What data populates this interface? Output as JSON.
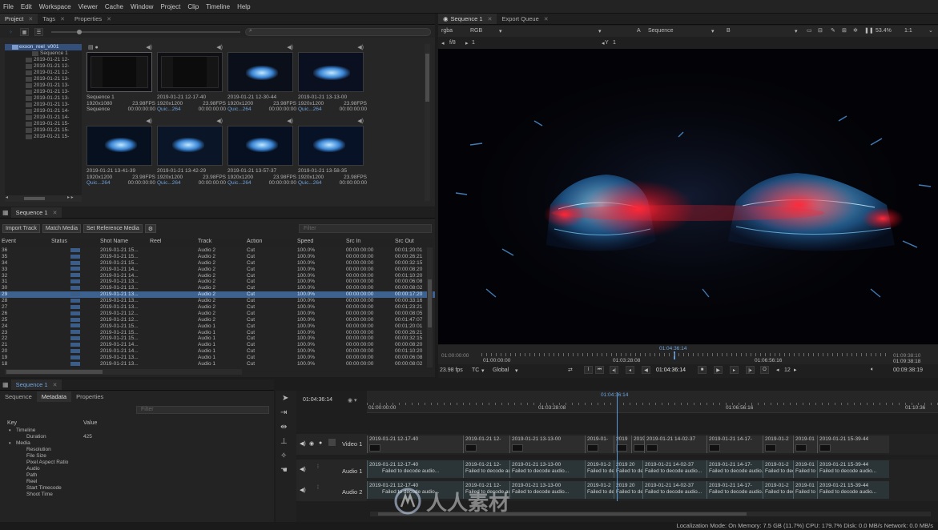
{
  "menu": [
    "File",
    "Edit",
    "Workspace",
    "Viewer",
    "Cache",
    "Window",
    "Project",
    "Clip",
    "Timeline",
    "Help"
  ],
  "project_panel": {
    "tabs": [
      "Project",
      "Tags",
      "Properties"
    ],
    "root_item": "exxon_reel_v001",
    "bin_items": [
      "Sequence 1",
      "2019-01-21 12-",
      "2019-01-21 12-",
      "2019-01-21 12-",
      "2019-01-21 13-",
      "2019-01-21 13-",
      "2019-01-21 13-",
      "2019-01-21 13-",
      "2019-01-21 13-",
      "2019-01-21 14-",
      "2019-01-21 14-",
      "2019-01-21 15-",
      "2019-01-21 15-",
      "2019-01-21 15-"
    ],
    "thumbnails": [
      {
        "name": "Sequence 1",
        "res": "1920x1080",
        "fps": "23.98FPS",
        "type": "Sequence",
        "tc": "00:00:00:00"
      },
      {
        "name": "2019-01-21 12-17-40",
        "res": "1920x1200",
        "fps": "23.98FPS",
        "type": "Quic...264",
        "tc": "00:00:00:00"
      },
      {
        "name": "2019-01-21 12-30-44",
        "res": "1920x1200",
        "fps": "23.98FPS",
        "type": "Quic...264",
        "tc": "00:00:00:00"
      },
      {
        "name": "2019-01-21 13-13-00",
        "res": "1920x1200",
        "fps": "23.98FPS",
        "type": "Quic...264",
        "tc": "00:00:00:00"
      },
      {
        "name": "2019-01-21 13-41-39",
        "res": "1920x1200",
        "fps": "23.98FPS",
        "type": "Quic...264",
        "tc": "00:00:00:00"
      },
      {
        "name": "2019-01-21 13-42-29",
        "res": "1920x1200",
        "fps": "23.98FPS",
        "type": "Quic...264",
        "tc": "00:00:00:00"
      },
      {
        "name": "2019-01-21 13-57-37",
        "res": "1920x1200",
        "fps": "23.98FPS",
        "type": "Quic...264",
        "tc": "00:00:00:00"
      },
      {
        "name": "2019-01-21 13-58-35",
        "res": "1920x1200",
        "fps": "23.98FPS",
        "type": "Quic...264",
        "tc": "00:00:00:00"
      }
    ]
  },
  "sequence_panel": {
    "tab": "Sequence 1",
    "buttons": [
      "Import Track",
      "Match Media",
      "Set Reference Media"
    ],
    "filter_placeholder": "Filter",
    "columns": [
      "Event",
      "Status",
      "Shot Name",
      "Reel",
      "Track",
      "Action",
      "Speed",
      "Src In",
      "Src Out"
    ],
    "rows": [
      [
        "36",
        "",
        "2019-01-21 15...",
        "",
        "Audio 2",
        "Cut",
        "100.0%",
        "00:00:00:00",
        "00:01:20:01"
      ],
      [
        "35",
        "",
        "2019-01-21 15...",
        "",
        "Audio 2",
        "Cut",
        "100.0%",
        "00:00:00:00",
        "00:00:26:21"
      ],
      [
        "34",
        "",
        "2019-01-21 15...",
        "",
        "Audio 2",
        "Cut",
        "100.0%",
        "00:00:00:00",
        "00:00:32:15"
      ],
      [
        "33",
        "",
        "2019-01-21 14...",
        "",
        "Audio 2",
        "Cut",
        "100.0%",
        "00:00:00:00",
        "00:00:08:20"
      ],
      [
        "32",
        "",
        "2019-01-21 14...",
        "",
        "Audio 2",
        "Cut",
        "100.0%",
        "00:00:00:00",
        "00:01:10:20"
      ],
      [
        "31",
        "",
        "2019-01-21 13...",
        "",
        "Audio 2",
        "Cut",
        "100.0%",
        "00:00:00:00",
        "00:00:06:08"
      ],
      [
        "30",
        "",
        "2019-01-21 13...",
        "",
        "Audio 2",
        "Cut",
        "100.0%",
        "00:00:00:00",
        "00:00:08:02"
      ],
      [
        "29",
        "",
        "2019-01-21 13...",
        "",
        "Audio 2",
        "Cut",
        "100.0%",
        "00:00:00:00",
        "00:00:17:20"
      ],
      [
        "28",
        "",
        "2019-01-21 13...",
        "",
        "Audio 2",
        "Cut",
        "100.0%",
        "00:00:00:00",
        "00:00:33:16"
      ],
      [
        "27",
        "",
        "2019-01-21 13...",
        "",
        "Audio 2",
        "Cut",
        "100.0%",
        "00:00:00:00",
        "00:01:23:21"
      ],
      [
        "26",
        "",
        "2019-01-21 12...",
        "",
        "Audio 2",
        "Cut",
        "100.0%",
        "00:00:00:00",
        "00:00:08:05"
      ],
      [
        "25",
        "",
        "2019-01-21 12...",
        "",
        "Audio 2",
        "Cut",
        "100.0%",
        "00:00:00:00",
        "00:01:47:07"
      ],
      [
        "24",
        "",
        "2019-01-21 15...",
        "",
        "Audio 1",
        "Cut",
        "100.0%",
        "00:00:00:00",
        "00:01:20:01"
      ],
      [
        "23",
        "",
        "2019-01-21 15...",
        "",
        "Audio 1",
        "Cut",
        "100.0%",
        "00:00:00:00",
        "00:00:26:21"
      ],
      [
        "22",
        "",
        "2019-01-21 15...",
        "",
        "Audio 1",
        "Cut",
        "100.0%",
        "00:00:00:00",
        "00:00:32:15"
      ],
      [
        "21",
        "",
        "2019-01-21 14...",
        "",
        "Audio 1",
        "Cut",
        "100.0%",
        "00:00:00:00",
        "00:00:08:20"
      ],
      [
        "20",
        "",
        "2019-01-21 14...",
        "",
        "Audio 1",
        "Cut",
        "100.0%",
        "00:00:00:00",
        "00:01:10:20"
      ],
      [
        "19",
        "",
        "2019-01-21 13...",
        "",
        "Audio 1",
        "Cut",
        "100.0%",
        "00:00:00:00",
        "00:00:06:08"
      ],
      [
        "18",
        "",
        "2019-01-21 13...",
        "",
        "Audio 1",
        "Cut",
        "100.0%",
        "00:00:00:00",
        "00:00:08:02"
      ]
    ],
    "selected_event": "29"
  },
  "viewer": {
    "tabs": [
      "Sequence 1",
      "Export Queue"
    ],
    "channel": "rgba",
    "colorspace": "RGB",
    "layer": "A",
    "sequence_name": "Sequence",
    "zoom": "53.4%",
    "ratio": "1:1",
    "fstop": "f/8",
    "exposure": "1",
    "gamma": "1",
    "tc_start": "01:00:00:00",
    "tc_end": "01:09:38:10",
    "tc_marker": "01:04:36:14",
    "tc_in": "01:00:00:00",
    "tc_mid1": "01:03:28:08",
    "tc_mid2": "01:06:56:16",
    "tc_out": "01:09:38:18",
    "fps": "23.98 fps",
    "tc_label": "TC",
    "global": "Global",
    "current_tc": "01:04:36:14",
    "step": "12",
    "duration": "00:09:38:19"
  },
  "metadata_panel": {
    "tab": "Sequence 1",
    "subtabs": [
      "Sequence",
      "Metadata",
      "Properties"
    ],
    "filter_placeholder": "Filter",
    "columns": [
      "Key",
      "Value"
    ],
    "rows": [
      {
        "key": "Timeline",
        "value": "",
        "indent": 0,
        "exp": true
      },
      {
        "key": "Duration",
        "value": "425",
        "indent": 1
      },
      {
        "key": "Media",
        "value": "",
        "indent": 0,
        "exp": true
      },
      {
        "key": "Resolution",
        "value": "",
        "indent": 1
      },
      {
        "key": "File Size",
        "value": "",
        "indent": 1
      },
      {
        "key": "Pixel Aspect Ratio",
        "value": "",
        "indent": 1
      },
      {
        "key": "Audio",
        "value": "",
        "indent": 1
      },
      {
        "key": "Path",
        "value": "",
        "indent": 1
      },
      {
        "key": "Reel",
        "value": "",
        "indent": 1
      },
      {
        "key": "Start Timecode",
        "value": "",
        "indent": 1
      },
      {
        "key": "Shoot Time",
        "value": "",
        "indent": 1
      }
    ]
  },
  "timeline": {
    "current_tc": "01:04:36:14",
    "ruler": [
      "01:00:00:00",
      "01:03:28:08",
      "01:04:36:14",
      "01:06:56:16",
      "01:10:36"
    ],
    "tracks": [
      "Video 1",
      "Audio 1",
      "Audio 2"
    ],
    "video_clips": [
      "2019-01-21 12-17-40",
      "2019-01-21 12-",
      "2019-01-21 13-13-00",
      "2019-01-",
      "2019",
      "2019-01",
      "2019-01-21 14-02-37",
      "2019-01-21 14-17-",
      "2019-01-2",
      "2019-01",
      "2019-01-21 15-39-44"
    ],
    "audio_clips": [
      "2019-01-21 12-17-40",
      "2019-01-21 12-",
      "2019-01-21 13-13-00",
      "2019-01-2",
      "2019 20",
      "2019-01-21 14-02-37",
      "2019-01-21 14-17-",
      "2019-01-2",
      "2019-01",
      "2019-01-21 15-39-44"
    ],
    "audio_fail": "Failed to decode audio..."
  },
  "watermark": "人人素材",
  "statusbar": "Localization Mode: On Memory: 7.5 GB (11.7%) CPU: 179.7% Disk: 0.0 MB/s Network: 0.0 MB/s"
}
